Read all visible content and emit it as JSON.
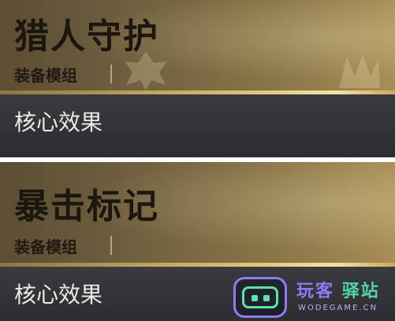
{
  "cards": [
    {
      "title": "猎人守护",
      "type_label": "装备模组",
      "effect_label": "核心效果"
    },
    {
      "title": "暴击标记",
      "type_label": "装备模组",
      "effect_label": "核心效果"
    }
  ],
  "watermark": {
    "brand_part1": "玩客",
    "brand_part2": "驿站",
    "url": "WODEGAME.CN",
    "icon": "robot-face-icon"
  },
  "colors": {
    "gold_accent": "#d6b86e",
    "header_bg": "#6e5e3e",
    "effect_bg": "#2f3034",
    "title_text": "#1b160e"
  }
}
